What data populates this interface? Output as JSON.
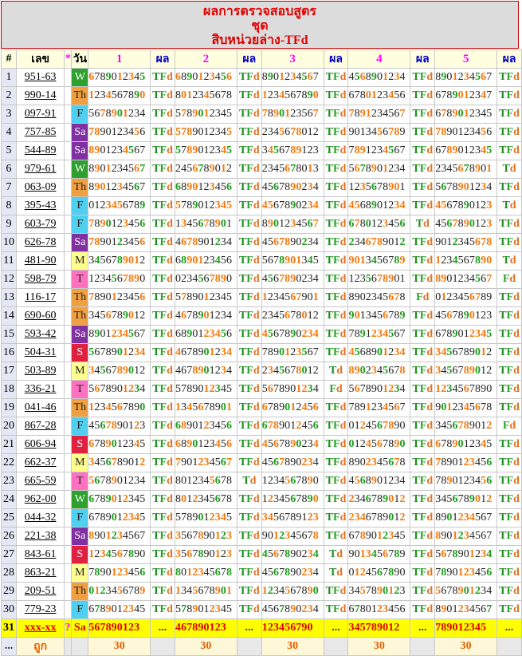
{
  "header": {
    "line1": "ผลการตรวจสอบสูตร",
    "line2": "ชุด",
    "line3": "สิบหน่วยล่าง-TFd"
  },
  "columns": {
    "no": "#",
    "lek": "เลข",
    "star": "*",
    "day": "วัน",
    "sets": [
      "1",
      "2",
      "3",
      "4",
      "5"
    ],
    "result": "ผล"
  },
  "rows": [
    {
      "no": "1",
      "lek": "951-63",
      "day": "W",
      "seqs": [
        "6789012345",
        "6890123456",
        "8901234567",
        "4568901234",
        "8901234567"
      ],
      "res": [
        "TFd",
        "TFd",
        "TFd",
        "TFd",
        "TFd"
      ],
      "hl": [
        [],
        [],
        [],
        [],
        []
      ]
    },
    {
      "no": "2",
      "lek": "990-14",
      "day": "Th",
      "seqs": [
        "1234567890",
        "8012345678",
        "1234567890",
        "6780123456",
        "6789012347"
      ],
      "res": [
        "TFd",
        "TFd",
        "TFd",
        "TFd",
        "TFd"
      ],
      "hl": [
        [],
        [],
        [],
        [],
        []
      ]
    },
    {
      "no": "3",
      "lek": "097-91",
      "day": "F",
      "seqs": [
        "5678901234",
        "5789012345",
        "7890123567",
        "7891234567",
        "6789012345"
      ],
      "res": [
        "TFd",
        "TFd",
        "TFd",
        "TFd",
        "TFd"
      ],
      "hl": [
        [],
        [],
        [],
        [],
        []
      ]
    },
    {
      "no": "4",
      "lek": "757-85",
      "day": "Sa",
      "seqs": [
        "7890123456",
        "5789012345",
        "2345678012",
        "9013456789",
        "7890123456"
      ],
      "res": [
        "TFd",
        "TFd",
        "TFd",
        "TFd",
        "TFd"
      ],
      "hl": [
        [],
        [],
        [],
        [],
        []
      ]
    },
    {
      "no": "5",
      "lek": "544-89",
      "day": "Sa",
      "seqs": [
        "8901234567",
        "5789012345",
        "3456789123",
        "7891234567",
        "6789012345"
      ],
      "res": [
        "TFd",
        "TFd",
        "TFd",
        "TFd",
        "TFd"
      ],
      "hl": [
        [],
        [],
        [],
        [],
        []
      ]
    },
    {
      "no": "6",
      "lek": "979-61",
      "day": "W",
      "seqs": [
        "8901234567",
        "2456789012",
        "2345678013",
        "5678901234",
        "2345678901"
      ],
      "res": [
        "TFd",
        "TFd",
        "TFd",
        "TFd",
        "Td"
      ],
      "hl": [
        [],
        [],
        [],
        [],
        []
      ]
    },
    {
      "no": "7",
      "lek": "063-09",
      "day": "Th",
      "seqs": [
        "8901234567",
        "6890123456",
        "4567890234",
        "1235678901",
        "5678901234"
      ],
      "res": [
        "TFd",
        "TFd",
        "TFd",
        "TFd",
        "TFd"
      ],
      "hl": [
        [],
        [],
        [],
        [],
        []
      ]
    },
    {
      "no": "8",
      "lek": "395-43",
      "day": "F",
      "seqs": [
        "0123456789",
        "5789012345",
        "4567890234",
        "4568901234",
        "4567890123"
      ],
      "res": [
        "TFd",
        "TFd",
        "TFd",
        "TFd",
        "Td"
      ],
      "hl": [
        [],
        [],
        [],
        [],
        []
      ]
    },
    {
      "no": "9",
      "lek": "603-79",
      "day": "F",
      "seqs": [
        "7890123456",
        "1345678901",
        "8901234567",
        "6780123456",
        "4567890123"
      ],
      "res": [
        "TFd",
        "TFd",
        "TFd",
        "Td",
        "TFd"
      ],
      "hl": [
        [],
        [],
        [],
        [],
        []
      ]
    },
    {
      "no": "10",
      "lek": "626-78",
      "day": "Sa",
      "seqs": [
        "7890123456",
        "4678901234",
        "4567890234",
        "2346789012",
        "9012345678"
      ],
      "res": [
        "TFd",
        "TFd",
        "TFd",
        "TFd",
        "TFd"
      ],
      "hl": [
        [],
        [],
        [],
        [],
        []
      ]
    },
    {
      "no": "11",
      "lek": "481-90",
      "day": "M",
      "seqs": [
        "3456789012",
        "6890123456",
        "5678901345",
        "9013456789",
        "1234567890"
      ],
      "res": [
        "TFd",
        "TFd",
        "TFd",
        "TFd",
        "Td"
      ],
      "hl": [
        [],
        [],
        [],
        [],
        []
      ]
    },
    {
      "no": "12",
      "lek": "598-79",
      "day": "T",
      "seqs": [
        "1234567890",
        "0234567890",
        "4567890234",
        "1235678901",
        "8901234567"
      ],
      "res": [
        "TFd",
        "TFd",
        "TFd",
        "TFd",
        "Fd"
      ],
      "hl": [
        [],
        [],
        [],
        [],
        []
      ]
    },
    {
      "no": "13",
      "lek": "116-17",
      "day": "Th",
      "seqs": [
        "7890123456",
        "5789012345",
        "1234567901",
        "8902345678",
        "0123456789"
      ],
      "res": [
        "TFd",
        "TFd",
        "TFd",
        "Fd",
        "TFd"
      ],
      "hl": [
        [],
        [],
        [],
        [],
        []
      ]
    },
    {
      "no": "14",
      "lek": "690-60",
      "day": "Th",
      "seqs": [
        "3456789012",
        "4678901234",
        "2345678012",
        "9013456789",
        "4567890123"
      ],
      "res": [
        "TFd",
        "TFd",
        "TFd",
        "TFd",
        "TFd"
      ],
      "hl": [
        [],
        [],
        [],
        [],
        []
      ]
    },
    {
      "no": "15",
      "lek": "593-42",
      "day": "Sa",
      "seqs": [
        "8901234567",
        "6890123456",
        "4567890234",
        "7891234567",
        "6789012345"
      ],
      "res": [
        "TFd",
        "TFd",
        "TFd",
        "TFd",
        "TFd"
      ],
      "hl": [
        [],
        [],
        [],
        [],
        []
      ]
    },
    {
      "no": "16",
      "lek": "504-31",
      "day": "S",
      "seqs": [
        "5678901234",
        "4678901234",
        "7890123567",
        "4568901234",
        "3456789012"
      ],
      "res": [
        "TFd",
        "TFd",
        "TFd",
        "TFd",
        "TFd"
      ],
      "hl": [
        [],
        [],
        [],
        [],
        []
      ]
    },
    {
      "no": "17",
      "lek": "503-89",
      "day": "M",
      "seqs": [
        "3456789012",
        "4678901234",
        "2345678012",
        "8902345678",
        "3456789012"
      ],
      "res": [
        "TFd",
        "TFd",
        "Td",
        "TFd",
        "TFd"
      ],
      "hl": [
        [],
        [],
        [],
        [],
        []
      ]
    },
    {
      "no": "18",
      "lek": "336-21",
      "day": "T",
      "seqs": [
        "5678901234",
        "5789012345",
        "5678901234",
        "5678901234",
        "1234567890"
      ],
      "res": [
        "TFd",
        "TFd",
        "Fd",
        "TFd",
        "TFd"
      ],
      "hl": [
        [],
        [],
        [],
        [],
        []
      ]
    },
    {
      "no": "19",
      "lek": "041-46",
      "day": "Th",
      "seqs": [
        "1234567890",
        "1345678901",
        "6789012456",
        "7891234567",
        "9012345678"
      ],
      "res": [
        "TFd",
        "TFd",
        "TFd",
        "TFd",
        "TFd"
      ],
      "hl": [
        [],
        [],
        [],
        [],
        []
      ]
    },
    {
      "no": "20",
      "lek": "867-28",
      "day": "F",
      "seqs": [
        "4567890123",
        "6890123456",
        "6789012456",
        "0124567890",
        "3456789012"
      ],
      "res": [
        "TFd",
        "TFd",
        "TFd",
        "TFd",
        "Fd"
      ],
      "hl": [
        [],
        [],
        [],
        [],
        []
      ]
    },
    {
      "no": "21",
      "lek": "606-94",
      "day": "S",
      "seqs": [
        "6789012345",
        "6890123456",
        "4567890234",
        "0124567890",
        "6789012345"
      ],
      "res": [
        "TFd",
        "TFd",
        "TFd",
        "TFd",
        "TFd"
      ],
      "hl": [
        [],
        [],
        [],
        [],
        []
      ]
    },
    {
      "no": "22",
      "lek": "662-37",
      "day": "M",
      "seqs": [
        "3456789012",
        "7901234567",
        "4567890234",
        "8902345678",
        "7890123456"
      ],
      "res": [
        "TFd",
        "TFd",
        "TFd",
        "TFd",
        "TFd"
      ],
      "hl": [
        [],
        [],
        [],
        [],
        []
      ]
    },
    {
      "no": "23",
      "lek": "665-59",
      "day": "T",
      "seqs": [
        "5678901234",
        "8012345678",
        "1234567890",
        "4568901234",
        "7890123456"
      ],
      "res": [
        "TFd",
        "Td",
        "TFd",
        "TFd",
        "TFd"
      ],
      "hl": [
        [],
        [],
        [],
        [],
        []
      ]
    },
    {
      "no": "24",
      "lek": "962-00",
      "day": "W",
      "seqs": [
        "6789012345",
        "8012345678",
        "1234567890",
        "2346789012",
        "3456789012"
      ],
      "res": [
        "TFd",
        "TFd",
        "TFd",
        "TFd",
        "TFd"
      ],
      "hl": [
        [],
        [],
        [],
        [],
        []
      ]
    },
    {
      "no": "25",
      "lek": "044-32",
      "day": "F",
      "seqs": [
        "6789012345",
        "5789012345",
        "3456789123",
        "2346789012",
        "8901234567"
      ],
      "res": [
        "TFd",
        "TFd",
        "TFd",
        "TFd",
        "TFd"
      ],
      "hl": [
        [],
        [],
        [],
        [],
        []
      ]
    },
    {
      "no": "26",
      "lek": "221-38",
      "day": "Sa",
      "seqs": [
        "8901234567",
        "3567890123",
        "9012345678",
        "6789012345",
        "8901234567"
      ],
      "res": [
        "TFd",
        "TFd",
        "TFd",
        "TFd",
        "TFd"
      ],
      "hl": [
        [],
        [],
        [],
        [],
        []
      ]
    },
    {
      "no": "27",
      "lek": "843-61",
      "day": "S",
      "seqs": [
        "1234567890",
        "3567890123",
        "4567890234",
        "9013456789",
        "5678901234"
      ],
      "res": [
        "TFd",
        "TFd",
        "Td",
        "TFd",
        "TFd"
      ],
      "hl": [
        [],
        [],
        [],
        [],
        []
      ]
    },
    {
      "no": "28",
      "lek": "863-21",
      "day": "M",
      "seqs": [
        "7890123456",
        "8012345678",
        "4567890234",
        "0124567890",
        "7890123456"
      ],
      "res": [
        "TFd",
        "TFd",
        "Td",
        "TFd",
        "TFd"
      ],
      "hl": [
        [],
        [],
        [],
        [],
        []
      ]
    },
    {
      "no": "29",
      "lek": "209-51",
      "day": "Th",
      "seqs": [
        "0123456789",
        "1345678901",
        "1234567890",
        "3457890123",
        "5678901234"
      ],
      "res": [
        "TFd",
        "TFd",
        "TFd",
        "TFd",
        "TFd"
      ],
      "hl": [
        [],
        [],
        [],
        [],
        []
      ]
    },
    {
      "no": "30",
      "lek": "779-23",
      "day": "F",
      "seqs": [
        "6789012345",
        "5789012345",
        "4567890234",
        "6780123456",
        "8901234567"
      ],
      "res": [
        "TFd",
        "TFd",
        "TFd",
        "TFd",
        "TFd"
      ],
      "hl": [
        [],
        [],
        [],
        [],
        []
      ]
    }
  ],
  "row31": {
    "no": "31",
    "lek": "xxx-xx",
    "star": "?",
    "day": "Sa",
    "seqs": [
      "567890123",
      "467890123",
      "123456790",
      "345789012",
      "789012345"
    ],
    "dots": "..."
  },
  "summary": {
    "dots": "...",
    "label": "ถูก",
    "counts": [
      "30",
      "30",
      "30",
      "30",
      "30"
    ]
  }
}
